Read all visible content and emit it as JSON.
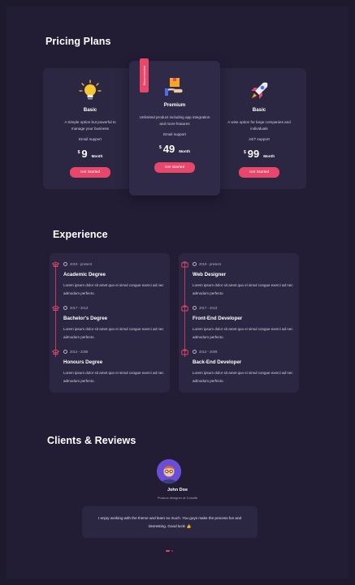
{
  "pricing": {
    "title": "Pricing Plans",
    "plans": [
      {
        "name": "Basic",
        "description": "A Simple option but powerful to manage your business",
        "support": "Email support",
        "currency": "$",
        "price": "9",
        "period": "Month",
        "button": "Get Started",
        "icon": "lightbulb-icon"
      },
      {
        "name": "Premium",
        "description": "Unlimited product including app integration and more features",
        "support": "Email support",
        "currency": "$",
        "price": "49",
        "period": "Month",
        "button": "Get Started",
        "icon": "hand-box-icon",
        "ribbon": "Recommended"
      },
      {
        "name": "Basic",
        "description": "A wise option for large companies and individuals",
        "support": "24/7 support",
        "currency": "$",
        "price": "99",
        "period": "Month",
        "button": "Get Started",
        "icon": "rocket-icon"
      }
    ]
  },
  "experience": {
    "title": "Experience",
    "education": [
      {
        "date": "2019 - present",
        "title": "Academic Degree",
        "text": "Lorem ipsum dolor sit amet quo ei simul congue exerci ad nec admodum perfecto."
      },
      {
        "date": "2017 - 2013",
        "title": "Bachelor's Degree",
        "text": "Lorem ipsum dolor sit amet quo ei simul congue exerci ad nec admodum perfecto."
      },
      {
        "date": "2013 - 2009",
        "title": "Honours Degree",
        "text": "Lorem ipsum dolor sit amet quo ei simul congue exerci ad nec admodum perfecto."
      }
    ],
    "work": [
      {
        "date": "2019 - present",
        "title": "Web Designer",
        "text": "Lorem ipsum dolor sit amet quo ei simul congue exerci ad nec admodum perfecto."
      },
      {
        "date": "2017 - 2013",
        "title": "Front-End Developer",
        "text": "Lorem ipsum dolor sit amet quo ei simul congue exerci ad nec admodum perfecto."
      },
      {
        "date": "2013 - 2009",
        "title": "Back-End Developer",
        "text": "Lorem ipsum dolor sit amet quo ei simul congue exerci ad nec admodum perfecto."
      }
    ]
  },
  "clients": {
    "title": "Clients & Reviews",
    "name": "John Doe",
    "role": "Product designer at Colorlib",
    "review": "I enjoy working with the theme and learn so much. You guys make the process fun and interesting. Good luck! 👍",
    "slides": 2,
    "active_slide": 0
  },
  "colors": {
    "accent": "#e8466b",
    "card": "#2b2642",
    "background": "#221d35"
  }
}
